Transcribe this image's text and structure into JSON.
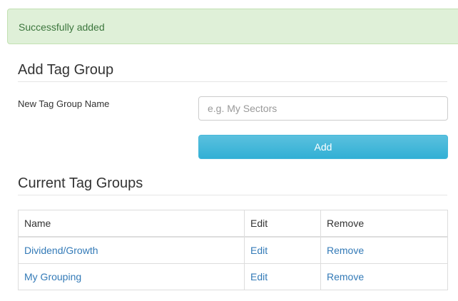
{
  "alert": {
    "message": "Successfully added"
  },
  "add_section": {
    "title": "Add Tag Group",
    "name_label": "New Tag Group Name",
    "name_placeholder": "e.g. My Sectors",
    "name_value": "",
    "add_label": "Add"
  },
  "current_section": {
    "title": "Current Tag Groups",
    "columns": [
      "Name",
      "Edit",
      "Remove"
    ],
    "rows": [
      {
        "name": "Dividend/Growth",
        "edit": "Edit",
        "remove": "Remove"
      },
      {
        "name": "My Grouping",
        "edit": "Edit",
        "remove": "Remove"
      }
    ]
  },
  "colors": {
    "success_bg": "#dff0d8",
    "success_text": "#3c763d",
    "button_accent": "#5bc0de",
    "link": "#337ab7"
  }
}
